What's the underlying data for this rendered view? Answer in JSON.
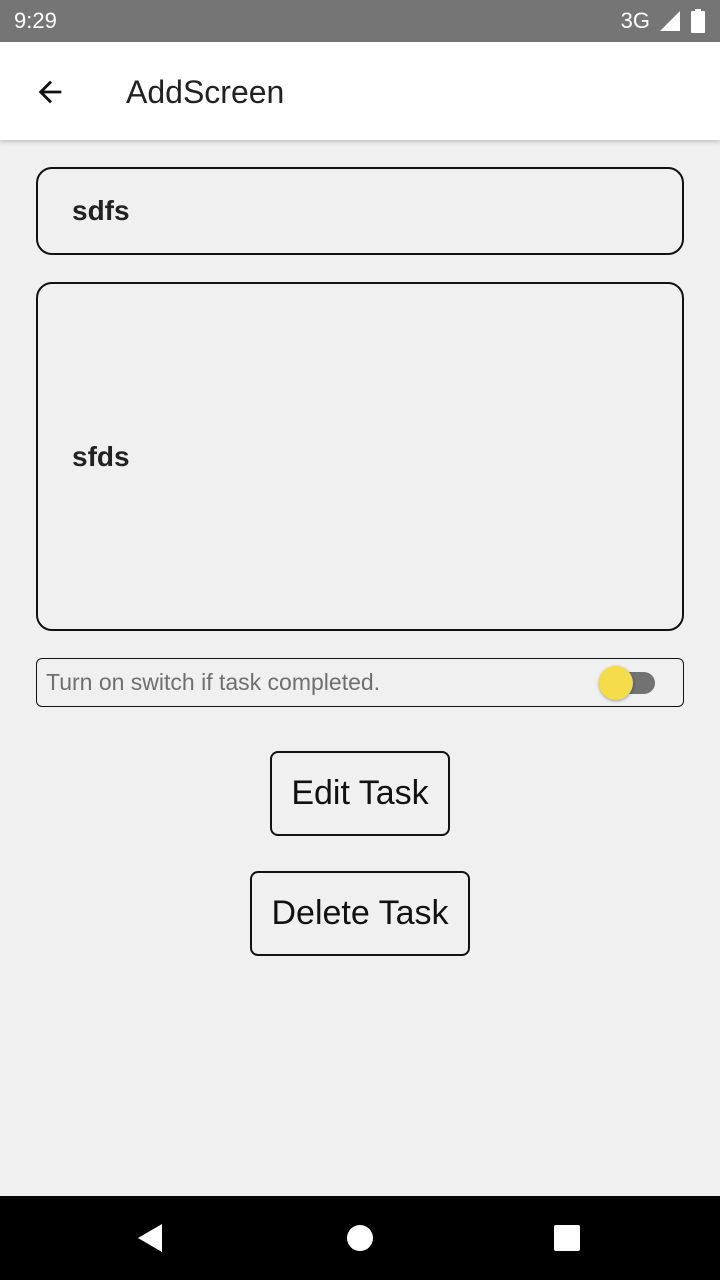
{
  "status_bar": {
    "time": "9:29",
    "network": "3G"
  },
  "app_bar": {
    "title": "AddScreen",
    "back_icon": "arrow-back-icon"
  },
  "form": {
    "title_value": "sdfs",
    "description_value": "sfds",
    "switch_label": "Turn on switch if task completed.",
    "switch_on": false,
    "switch_thumb_color": "#f5dc4a"
  },
  "buttons": {
    "edit_label": "Edit Task",
    "delete_label": "Delete Task"
  },
  "nav_bar": {
    "icons": [
      "nav-back-icon",
      "nav-home-icon",
      "nav-recents-icon"
    ]
  }
}
